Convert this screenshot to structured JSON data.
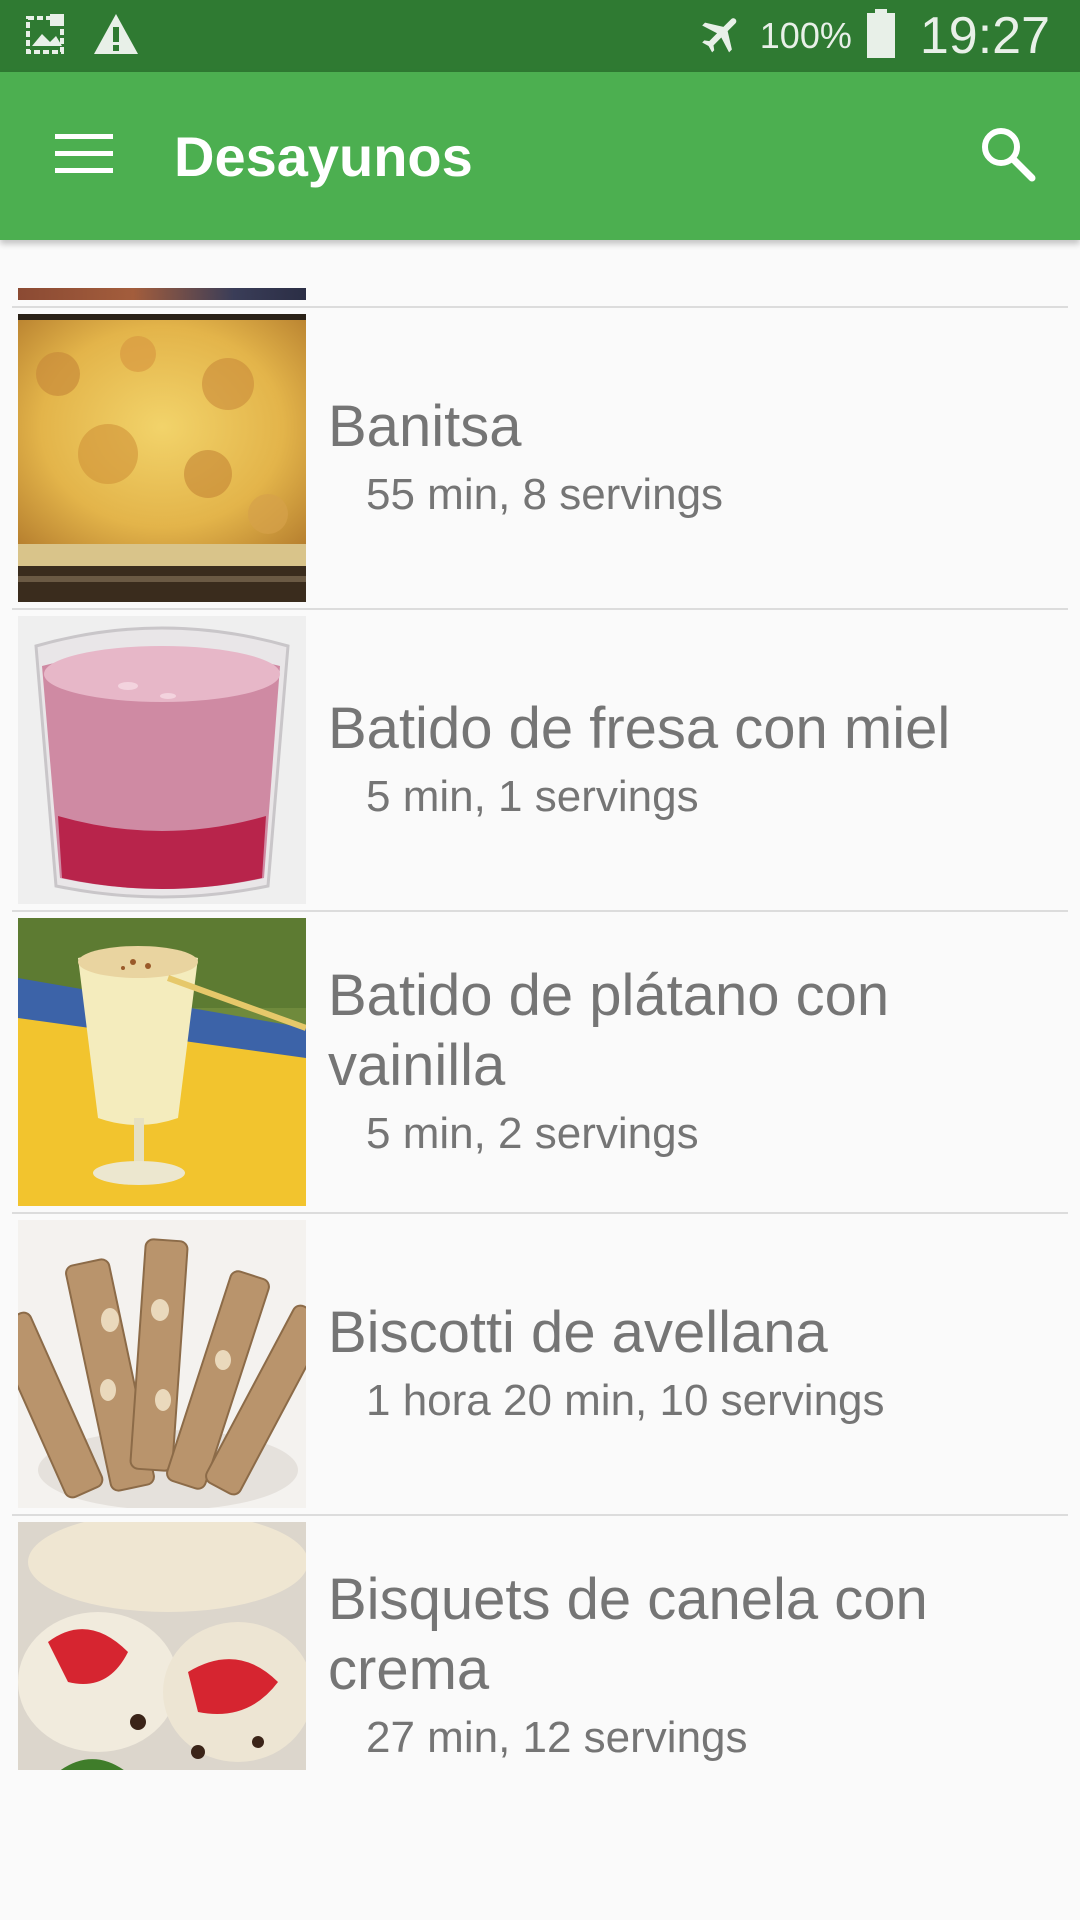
{
  "status_bar": {
    "battery_percent": "100%",
    "time": "19:27",
    "icons": [
      "photo-icon",
      "warning-icon",
      "airplane-mode-icon",
      "battery-icon"
    ]
  },
  "app_bar": {
    "title": "Desayunos",
    "icons": [
      "menu-icon",
      "search-icon"
    ],
    "color": "#4caf50"
  },
  "recipes": [
    {
      "title": "Banitsa",
      "meta": "55 min, 8 servings"
    },
    {
      "title": "Batido de fresa con miel",
      "meta": "5 min, 1 servings"
    },
    {
      "title": "Batido de plátano con vainilla",
      "meta": "5 min, 2 servings"
    },
    {
      "title": "Biscotti de avellana",
      "meta": "1 hora 20 min, 10 servings"
    },
    {
      "title": "Bisquets de canela con crema",
      "meta": "27 min, 12 servings"
    }
  ]
}
